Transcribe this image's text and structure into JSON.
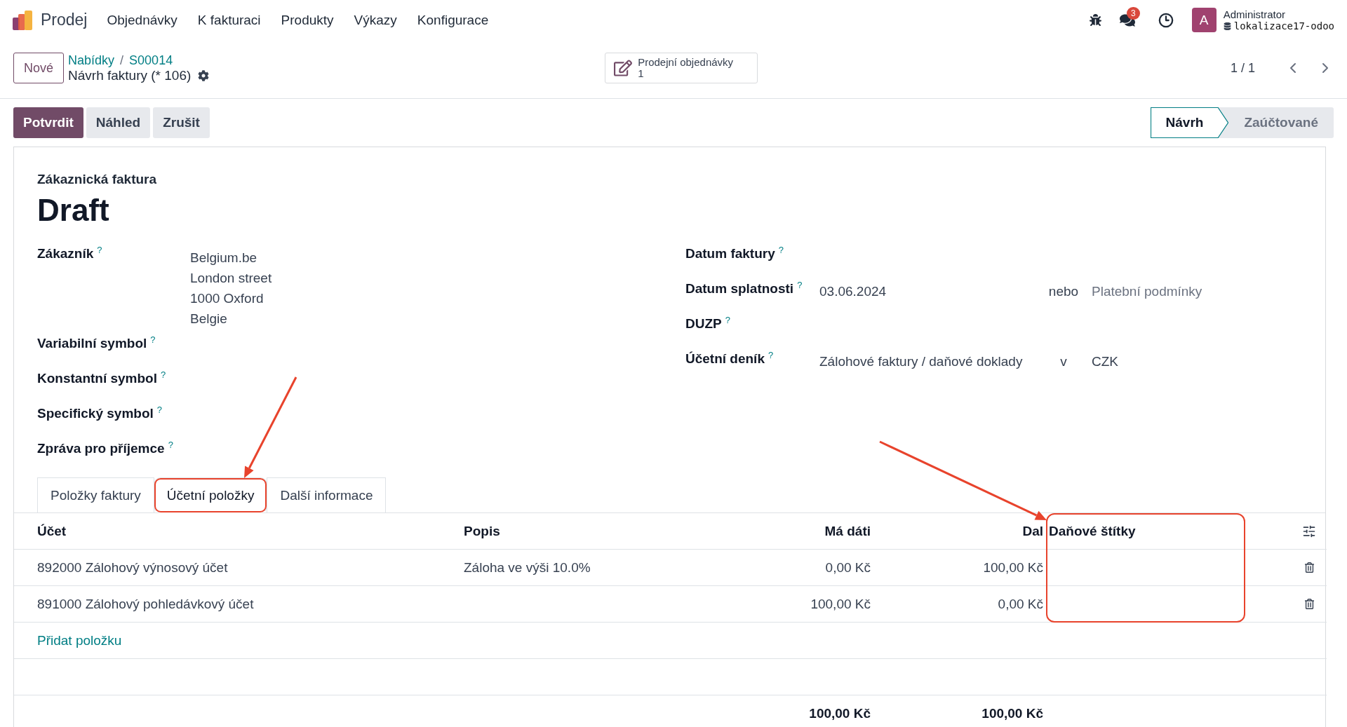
{
  "navbar": {
    "app_name": "Prodej",
    "menu": [
      "Objednávky",
      "K fakturaci",
      "Produkty",
      "Výkazy",
      "Konfigurace"
    ],
    "chat_badge": "3",
    "avatar_letter": "A",
    "user_name": "Administrator",
    "database": "lokalizace17-odoo"
  },
  "control_panel": {
    "new_button": "Nové",
    "breadcrumb": [
      "Nabídky",
      "S00014"
    ],
    "breadcrumb_separator": "/",
    "record_title": "Návrh faktury (* 106)",
    "smart_button": {
      "label": "Prodejní objednávky",
      "count": "1"
    },
    "pager": "1 / 1"
  },
  "actions": [
    {
      "label": "Potvrdit",
      "primary": true
    },
    {
      "label": "Náhled",
      "primary": false
    },
    {
      "label": "Zrušit",
      "primary": false
    }
  ],
  "status": [
    {
      "label": "Návrh",
      "selected": true
    },
    {
      "label": "Zaúčtované",
      "selected": false
    }
  ],
  "sheet": {
    "document_type": "Zákaznická faktura",
    "name": "Draft",
    "left_fields": [
      {
        "label": "Zákazník",
        "help": "?",
        "values": [
          "Belgium.be",
          "London street",
          "1000 Oxford",
          "Belgie"
        ]
      },
      {
        "label": "Variabilní symbol",
        "help": "?"
      },
      {
        "label": "Konstantní symbol",
        "help": "?"
      },
      {
        "label": "Specifický symbol",
        "help": "?"
      },
      {
        "label": "Zpráva pro příjemce",
        "help": "?"
      }
    ],
    "right_fields": [
      {
        "label": "Datum faktury",
        "help": "?"
      },
      {
        "label": "Datum splatnosti",
        "help": "?",
        "parts": [
          {
            "kind": "value",
            "text": "03.06.2024"
          },
          {
            "kind": "connector",
            "text": "nebo"
          },
          {
            "kind": "placeholder",
            "text": "Platební podmínky"
          }
        ]
      },
      {
        "label": "DUZP",
        "help": "?"
      },
      {
        "label": "Účetní deník",
        "help": "?",
        "parts": [
          {
            "kind": "value",
            "text": "Zálohové faktury / daňové doklady"
          },
          {
            "kind": "connector",
            "text": "v"
          },
          {
            "kind": "value",
            "text": "CZK"
          }
        ]
      }
    ],
    "tabs": [
      {
        "label": "Položky faktury",
        "selected": false,
        "highlighted": false
      },
      {
        "label": "Účetní položky",
        "selected": true,
        "highlighted": true
      },
      {
        "label": "Další informace",
        "selected": false,
        "highlighted": false
      }
    ],
    "table": {
      "columns": [
        {
          "label": "Účet",
          "kind": "text",
          "highlighted": false
        },
        {
          "label": "Popis",
          "kind": "text",
          "highlighted": false
        },
        {
          "label": "Má dáti",
          "kind": "amount",
          "highlighted": false
        },
        {
          "label": "Dal",
          "kind": "amount",
          "highlighted": false
        },
        {
          "label": "Daňové štítky",
          "kind": "text",
          "highlighted": true
        }
      ],
      "rows": [
        [
          "892000 Zálohový výnosový účet",
          "Záloha ve výši 10.0%",
          "0,00 Kč",
          "100,00 Kč",
          ""
        ],
        [
          "891000 Zálohový pohledávkový účet",
          "",
          "100,00 Kč",
          "0,00 Kč",
          ""
        ]
      ],
      "add_line": "Přidat položku",
      "totals": [
        "100,00 Kč",
        "100,00 Kč"
      ]
    }
  }
}
